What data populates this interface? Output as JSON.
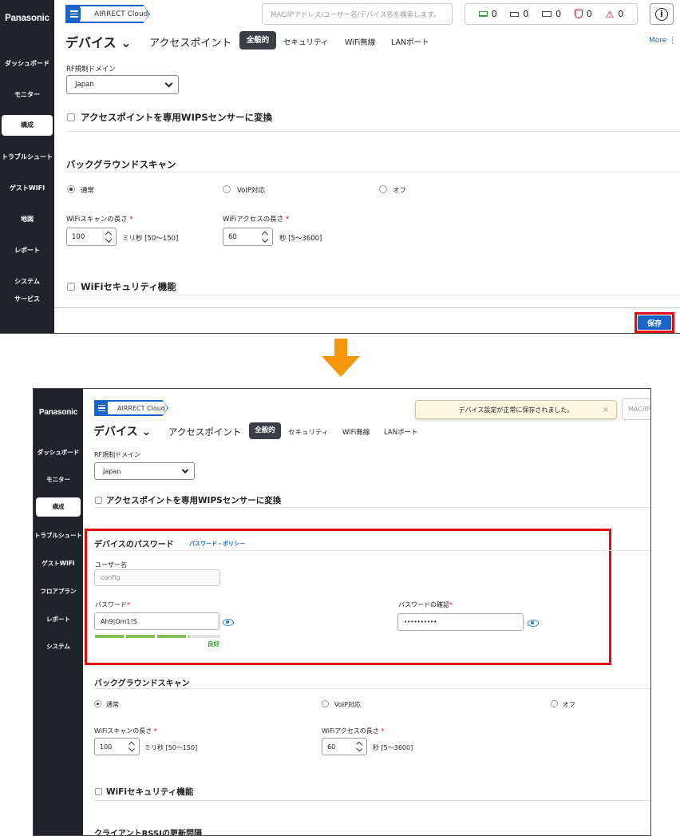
{
  "colors": {
    "brand_blue": "#1b63c9",
    "sidebar": "#20232a",
    "highlight_red": "#e00d0d",
    "arrow_orange": "#f5960d",
    "strength_green": "#7ec154"
  },
  "top": {
    "logo": "Panasonic",
    "brand": "AIRRECT Cloud",
    "search_placeholder": "MAC/IPアドレス/ユーザー名/デバイス名を検索します。",
    "stats": [
      {
        "icon": "laptop-icon",
        "value": "0"
      },
      {
        "icon": "router-icon",
        "value": "0"
      },
      {
        "icon": "switch-icon",
        "value": "0"
      },
      {
        "icon": "shield-icon",
        "value": "0"
      },
      {
        "icon": "warning-icon",
        "value": "0"
      }
    ],
    "nav": [
      "ダッシュボード",
      "モニター",
      "構成",
      "トラブルシュート",
      "ゲストWIFI",
      "地図",
      "レポート",
      "システム",
      "サービス"
    ],
    "page_title": "デバイス ⌄",
    "tabs": [
      "アクセスポイント",
      "全般的",
      "セキュリティ",
      "WiFi無線",
      "LANポート"
    ],
    "more": "More ⋮",
    "rf_label": "RF規制ドメイン",
    "rf_value": "Japan",
    "wips": "アクセスポイントを専用WIPSセンサーに変換",
    "bg_scan": "バックグラウンドスキャン",
    "radio_normal": "通常",
    "radio_voip": "VoIP対応",
    "radio_off": "オフ",
    "scan_len_label": "WiFiスキャンの長さ",
    "scan_len_value": "100",
    "scan_len_unit": "ミリ秒 [50～150]",
    "access_len_label": "WiFiアクセスの長さ",
    "access_len_value": "60",
    "access_len_unit": "秒 [5～3600]",
    "wifi_sec": "WiFiセキュリティ機能",
    "save": "保存"
  },
  "bottom": {
    "logo": "Panasonic",
    "brand": "AIRRECT Cloud",
    "search_placeholder": "MAC/IP",
    "toast": "デバイス設定が正常に保存されました。",
    "toast_close": "×",
    "nav": [
      "ダッシュボード",
      "モニター",
      "構成",
      "トラブルシュート",
      "ゲストWIFI",
      "フロアプラン",
      "レポート",
      "システム"
    ],
    "page_title": "デバイス ⌄",
    "tabs": [
      "アクセスポイント",
      "全般的",
      "セキュリティ",
      "WiFi無線",
      "LANポート"
    ],
    "rf_label": "RF規制ドメイン",
    "rf_value": "Japan",
    "wips": "アクセスポイントを専用WIPSセンサーに変換",
    "pw_section": "デバイスのパスワード",
    "pw_policy": "パスワード・ポリシー",
    "user_label": "ユーザー名",
    "user_value": "config",
    "pw_label": "パスワード",
    "pw_value": "Ah9|Om1!S",
    "pw_confirm_label": "パスワードの確認",
    "pw_confirm_value": "••••••••••",
    "strength": "良好",
    "strength_level": 0.75,
    "bg_scan": "バックグラウンドスキャン",
    "radio_normal": "通常",
    "radio_voip": "VoIP対応",
    "radio_off": "オフ",
    "scan_len_label": "WiFiスキャンの長さ",
    "scan_len_value": "100",
    "scan_len_unit": "ミリ秒 [50～150]",
    "access_len_label": "WiFiアクセスの長さ",
    "access_len_value": "60",
    "access_len_unit": "秒 [5～3600]",
    "wifi_sec": "WiFiセキュリティ機能",
    "client_rssi": "クライアントRSSIの更新間隔"
  }
}
